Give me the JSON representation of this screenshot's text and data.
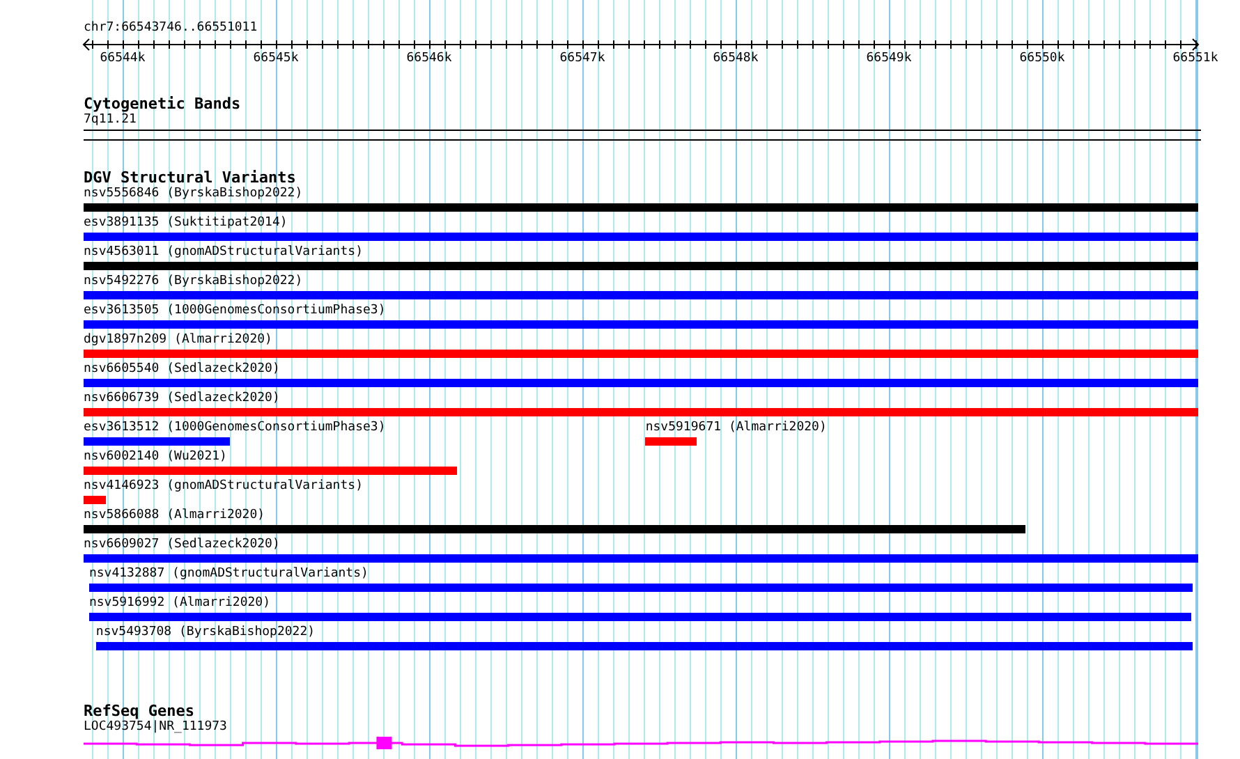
{
  "ruler": {
    "location": "chr7:66543746..66551011",
    "ticks": [
      "66544k",
      "66545k",
      "66546k",
      "66547k",
      "66548k",
      "66549k",
      "66550k",
      "66551k"
    ]
  },
  "cytogenetic_bands": {
    "title": "Cytogenetic Bands",
    "band": "7q11.21"
  },
  "dgv": {
    "title": "DGV Structural Variants",
    "rows": [
      {
        "features": [
          {
            "label": "nsv5556846 (ByrskaBishop2022)",
            "color": "#000000"
          }
        ]
      },
      {
        "features": [
          {
            "label": "esv3891135 (Suktitipat2014)",
            "color": "#0000ff"
          }
        ]
      },
      {
        "features": [
          {
            "label": "nsv4563011 (gnomADStructuralVariants)",
            "color": "#000000"
          }
        ]
      },
      {
        "features": [
          {
            "label": "nsv5492276 (ByrskaBishop2022)",
            "color": "#0000ff"
          }
        ]
      },
      {
        "features": [
          {
            "label": "esv3613505 (1000GenomesConsortiumPhase3)",
            "color": "#0000ff"
          }
        ]
      },
      {
        "features": [
          {
            "label": "dgv1897n209 (Almarri2020)",
            "color": "#ff0000"
          }
        ]
      },
      {
        "features": [
          {
            "label": "nsv6605540 (Sedlazeck2020)",
            "color": "#0000ff"
          }
        ]
      },
      {
        "features": [
          {
            "label": "nsv6606739 (Sedlazeck2020)",
            "color": "#ff0000"
          }
        ]
      },
      {
        "features": [
          {
            "label": "esv3613512 (1000GenomesConsortiumPhase3)",
            "color": "#0000ff"
          },
          {
            "label": "nsv5919671 (Almarri2020)",
            "color": "#ff0000"
          }
        ]
      },
      {
        "features": [
          {
            "label": "nsv6002140 (Wu2021)",
            "color": "#ff0000"
          }
        ]
      },
      {
        "features": [
          {
            "label": "nsv4146923 (gnomADStructuralVariants)",
            "color": "#ff0000"
          }
        ]
      },
      {
        "features": [
          {
            "label": "nsv5866088 (Almarri2020)",
            "color": "#000000"
          }
        ]
      },
      {
        "features": [
          {
            "label": "nsv6609027 (Sedlazeck2020)",
            "color": "#0000ff"
          }
        ]
      },
      {
        "features": [
          {
            "label": "nsv4132887 (gnomADStructuralVariants)",
            "color": "#0000ff"
          }
        ]
      },
      {
        "features": [
          {
            "label": "nsv5916992 (Almarri2020)",
            "color": "#0000ff"
          }
        ]
      },
      {
        "features": [
          {
            "label": "nsv5493708 (ByrskaBishop2022)",
            "color": "#0000ff"
          }
        ]
      }
    ]
  },
  "refseq": {
    "title": "RefSeq Genes",
    "genes": [
      {
        "label": "LOC493754|NR_111973",
        "color": "#ff00ff"
      }
    ]
  }
}
